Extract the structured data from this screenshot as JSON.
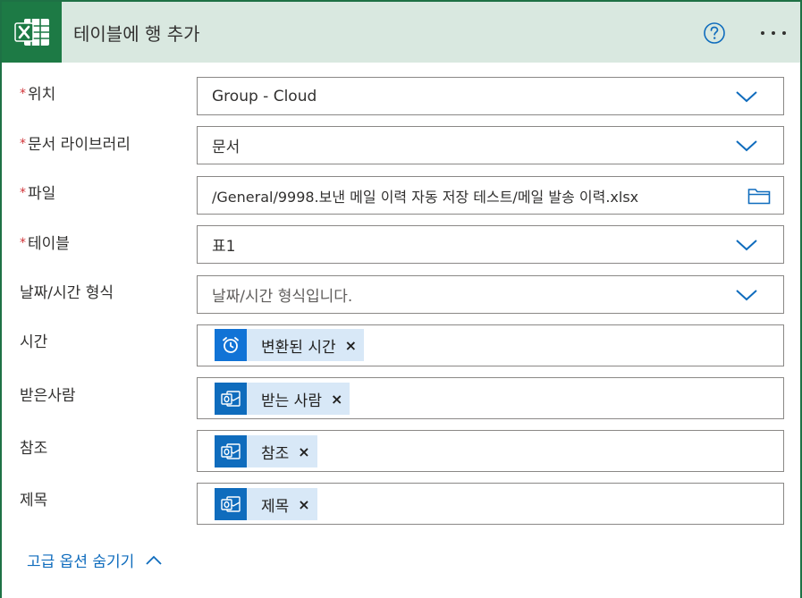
{
  "header": {
    "title": "테이블에 행 추가",
    "app_icon": "excel-icon",
    "help_icon": "help-icon",
    "more_icon": "more-icon"
  },
  "colors": {
    "accent": "#1e7145",
    "header_bg": "#d9e8e0",
    "link": "#0f6cbd",
    "required": "#d13438"
  },
  "fields": {
    "location": {
      "label": "위치",
      "required": "*",
      "value": "Group - Cloud"
    },
    "library": {
      "label": "문서 라이브러리",
      "required": "*",
      "value": "문서"
    },
    "file": {
      "label": "파일",
      "required": "*",
      "value": "/General/9998.보낸 메일 이력 자동 저장 테스트/메일 발송 이력.xlsx"
    },
    "table": {
      "label": "테이블",
      "required": "*",
      "value": "표1"
    },
    "datetime_format": {
      "label": "날짜/시간 형식",
      "placeholder": "날짜/시간 형식입니다."
    },
    "time": {
      "label": "시간",
      "token": "변환된 시간",
      "token_icon": "alarm-clock-icon"
    },
    "to": {
      "label": "받은사람",
      "token": "받는 사람",
      "token_icon": "outlook-icon"
    },
    "cc": {
      "label": "참조",
      "token": "참조",
      "token_icon": "outlook-icon"
    },
    "subject": {
      "label": "제목",
      "token": "제목",
      "token_icon": "outlook-icon"
    }
  },
  "token_remove": "×",
  "advanced_toggle": "고급 옵션 숨기기"
}
